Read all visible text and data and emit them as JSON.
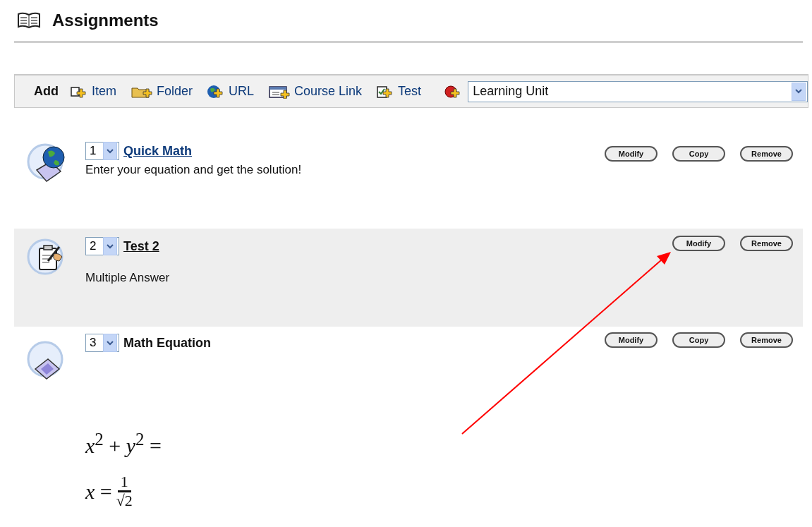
{
  "page": {
    "title": "Assignments"
  },
  "toolbar": {
    "label": "Add",
    "actions": [
      {
        "kind": "item",
        "label": "Item"
      },
      {
        "kind": "folder",
        "label": "Folder"
      },
      {
        "kind": "url",
        "label": "URL"
      },
      {
        "kind": "course-link",
        "label": "Course Link"
      },
      {
        "kind": "test",
        "label": "Test"
      }
    ],
    "select": {
      "value": "Learning Unit"
    }
  },
  "items": [
    {
      "kind": "link",
      "order": "1",
      "title": "Quick Math",
      "linked": true,
      "highlighted": false,
      "description": "Enter your equation and get the solution!",
      "buttons": [
        "Modify",
        "Copy",
        "Remove"
      ]
    },
    {
      "kind": "test",
      "order": "2",
      "title": "Test 2",
      "linked": true,
      "highlighted": true,
      "description": "Multiple Answer",
      "buttons": [
        "Modify",
        "Remove"
      ]
    },
    {
      "kind": "equation",
      "order": "3",
      "title": "Math Equation",
      "linked": false,
      "highlighted": false,
      "buttons": [
        "Modify",
        "Copy",
        "Remove"
      ],
      "equations": [
        {
          "kind": "inline",
          "text": "*x*$^{2}$ + *y*$^{2}$ ="
        },
        {
          "kind": "fraction",
          "lhs": "*x* =",
          "numerator": "1",
          "denominator": "√2"
        }
      ]
    }
  ]
}
